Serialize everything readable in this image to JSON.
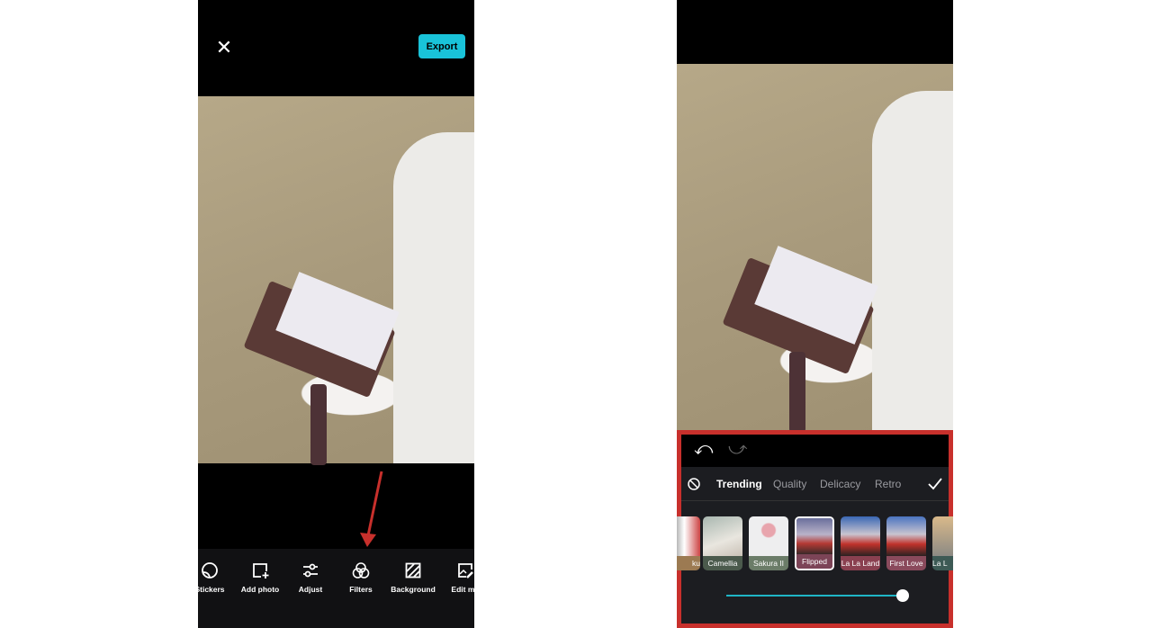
{
  "left_screen": {
    "close_icon": "close-icon",
    "export_label": "Export",
    "toolbar": [
      {
        "label": "Stickers",
        "icon": "sticker-icon"
      },
      {
        "label": "Add photo",
        "icon": "add-photo-icon"
      },
      {
        "label": "Adjust",
        "icon": "sliders-icon"
      },
      {
        "label": "Filters",
        "icon": "filters-icon"
      },
      {
        "label": "Background",
        "icon": "background-icon"
      },
      {
        "label": "Edit mo",
        "icon": "edit-image-icon"
      }
    ],
    "annotation_color": "#c8302c"
  },
  "right_screen": {
    "undo_icon": "undo-icon",
    "redo_icon": "redo-icon",
    "tabs": [
      {
        "label": "Trending",
        "active": true
      },
      {
        "label": "Quality"
      },
      {
        "label": "Delicacy"
      },
      {
        "label": "Retro"
      }
    ],
    "filters": [
      {
        "label": "ku",
        "color": "#9c7a52"
      },
      {
        "label": "Camellia",
        "color": "#4b5a4c"
      },
      {
        "label": "Sakura II",
        "color": "#6b7c68"
      },
      {
        "label": "Flipped",
        "color": "#7c4457",
        "selected": true
      },
      {
        "label": "La La Land",
        "color": "#8a4050"
      },
      {
        "label": "First Love",
        "color": "#8a4a5c"
      },
      {
        "label": "La L",
        "color": "#3d5a55"
      }
    ],
    "intensity_percent": 100,
    "accent": "#1fb5c6",
    "highlight_color": "#c8302c"
  }
}
